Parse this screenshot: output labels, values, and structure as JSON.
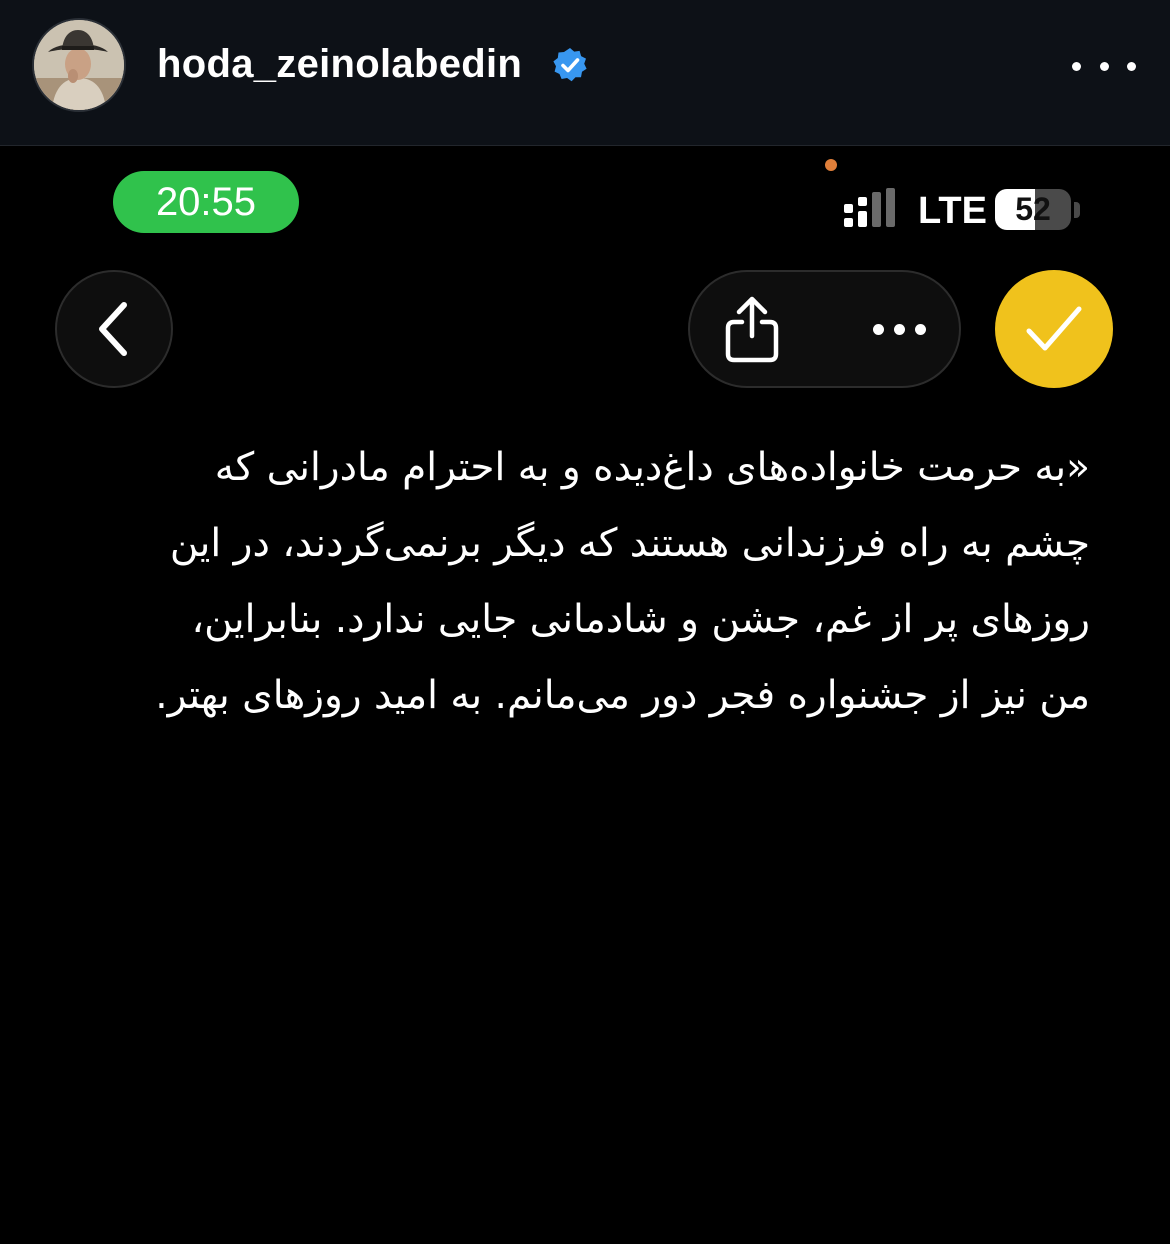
{
  "post_header": {
    "username": "hoda_zeinolabedin",
    "verified_icon": "verified-badge-icon",
    "more_icon": "more-horizontal-icon"
  },
  "status_bar": {
    "time": "20:55",
    "network": "LTE",
    "battery_level": 52,
    "battery_text": "52",
    "signal_icon": "signal-strength-icon",
    "time_pill_color": "#30c24c",
    "indicator_dot_color": "#e07f3a"
  },
  "toolbar": {
    "back_icon": "chevron-left-icon",
    "share_icon": "share-icon",
    "more_icon": "more-horizontal-icon",
    "done_icon": "checkmark-icon",
    "done_color": "#f0c21c"
  },
  "note": {
    "lines": [
      "«به حرمت خانواده‌های داغ‌دیده و به احترام مادرانی که",
      "چشم به راه فرزندانی هستند که دیگر برنمی‌گردند، در این",
      "روزهای پر از غم، جشن و شادمانی جایی ندارد. بنابراین،",
      "من نیز از جشنواره فجر دور می‌مانم. به امید روزهای بهتر."
    ]
  }
}
